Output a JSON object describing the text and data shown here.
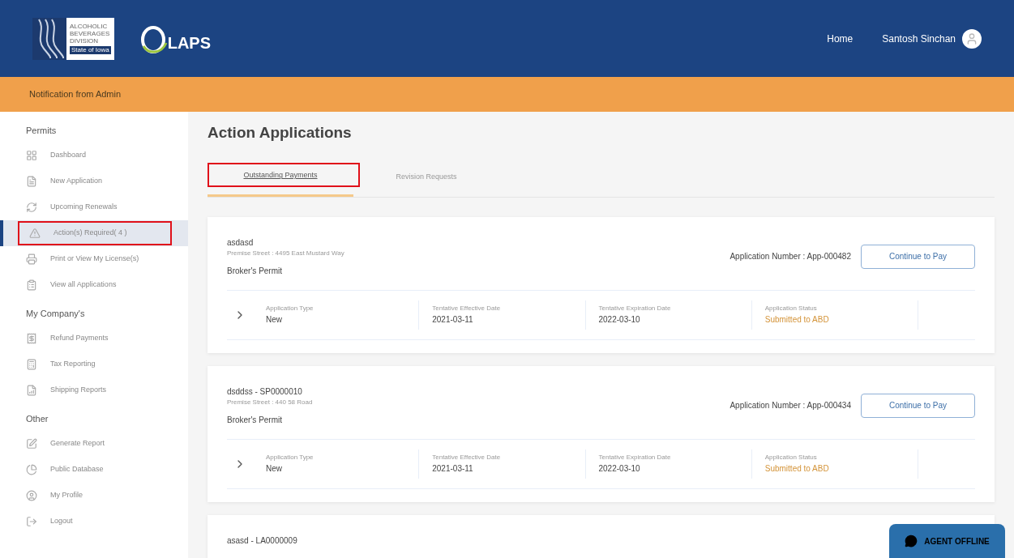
{
  "header": {
    "logo_lines": [
      "ALCOHOLIC",
      "BEVERAGES",
      "DIVISION"
    ],
    "logo_state": "State of Iowa",
    "brand": "LAPS",
    "nav": [
      {
        "label": "Home"
      }
    ],
    "user": "Santosh Sinchan"
  },
  "notification": "Notification from Admin",
  "sidebar": [
    {
      "heading": "Permits",
      "items": [
        {
          "label": "Dashboard",
          "selected": false,
          "annotated": false
        },
        {
          "label": "New Application",
          "selected": false,
          "annotated": false
        },
        {
          "label": "Upcoming Renewals",
          "selected": false,
          "annotated": false
        },
        {
          "label": "Action(s) Required( 4 )",
          "selected": true,
          "annotated": true
        },
        {
          "label": "Print or View My License(s)",
          "selected": false,
          "annotated": false
        },
        {
          "label": "View all Applications",
          "selected": false,
          "annotated": false
        }
      ]
    },
    {
      "heading": "My Company's",
      "items": [
        {
          "label": "Refund Payments",
          "selected": false,
          "annotated": false
        },
        {
          "label": "Tax Reporting",
          "selected": false,
          "annotated": false
        },
        {
          "label": "Shipping Reports",
          "selected": false,
          "annotated": false
        }
      ]
    },
    {
      "heading": "Other",
      "items": [
        {
          "label": "Generate Report",
          "selected": false,
          "annotated": false
        },
        {
          "label": "Public Database",
          "selected": false,
          "annotated": false
        },
        {
          "label": "My Profile",
          "selected": false,
          "annotated": false
        },
        {
          "label": "Logout",
          "selected": false,
          "annotated": false
        }
      ]
    }
  ],
  "page_title": "Action Applications",
  "tabs": [
    {
      "label": "Outstanding Payments",
      "selected": true,
      "annotated": true
    },
    {
      "label": "Revision Requests",
      "selected": false,
      "annotated": false
    }
  ],
  "applications": [
    {
      "title": "asdasd",
      "street": "Premise Street : 4495 East Mustard Way",
      "permit": "Broker's Permit",
      "number": "Application Number : App-000482",
      "button": "Continue to Pay",
      "details": [
        {
          "label": "Application Type",
          "value": "New",
          "kind": "plain"
        },
        {
          "label": "Tentative Effective Date",
          "value": "2021-03-11",
          "kind": "plain"
        },
        {
          "label": "Tentative Expiration Date",
          "value": "2022-03-10",
          "kind": "plain"
        },
        {
          "label": "Application Status",
          "value": "Submitted to ABD",
          "kind": "status"
        }
      ]
    },
    {
      "title": "dsddss - SP0000010",
      "street": "Premise Street : 440 58 Road",
      "permit": "Broker's Permit",
      "number": "Application Number : App-000434",
      "button": "Continue to Pay",
      "details": [
        {
          "label": "Application Type",
          "value": "New",
          "kind": "plain"
        },
        {
          "label": "Tentative Effective Date",
          "value": "2021-03-11",
          "kind": "plain"
        },
        {
          "label": "Tentative Expiration Date",
          "value": "2022-03-10",
          "kind": "plain"
        },
        {
          "label": "Application Status",
          "value": "Submitted to ABD",
          "kind": "status"
        }
      ]
    },
    {
      "title": "asasd - LA0000009"
    }
  ],
  "chat": {
    "label": "AGENT OFFLINE"
  }
}
